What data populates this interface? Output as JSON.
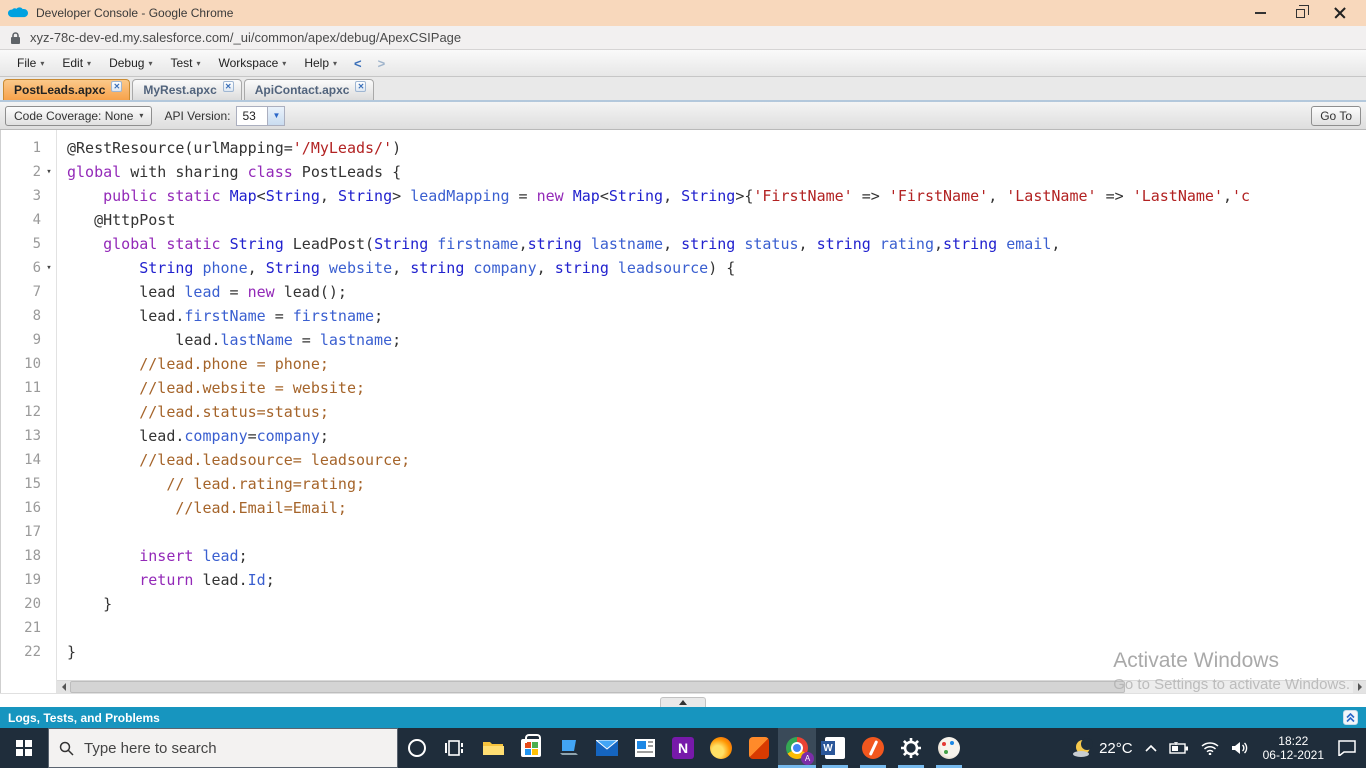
{
  "window": {
    "title": "Developer Console - Google Chrome"
  },
  "urlbar": {
    "url": "xyz-78c-dev-ed.my.salesforce.com/_ui/common/apex/debug/ApexCSIPage"
  },
  "menubar": {
    "items": [
      "File",
      "Edit",
      "Debug",
      "Test",
      "Workspace",
      "Help"
    ],
    "nav_back": "<",
    "nav_forward": ">"
  },
  "tabs": [
    {
      "label": "PostLeads.apxc",
      "active": true,
      "close": "✕"
    },
    {
      "label": "MyRest.apxc",
      "active": false,
      "close": "✕"
    },
    {
      "label": "ApiContact.apxc",
      "active": false,
      "close": "✕"
    }
  ],
  "toolbar": {
    "code_coverage_label": "Code Coverage: None",
    "api_version_label": "API Version:",
    "api_version_value": "53",
    "goto_label": "Go To"
  },
  "editor": {
    "colors": {
      "k": "#9329B8",
      "t": "#2121CE",
      "v": "#3A5FD0",
      "s": "#B22222",
      "c": "#A5642A",
      "p": "#333333"
    },
    "lines": [
      {
        "n": 1,
        "fold": false,
        "toks": [
          [
            "p",
            "@RestResource(urlMapping="
          ],
          [
            "s",
            "'/MyLeads/'"
          ],
          [
            "p",
            ")"
          ]
        ]
      },
      {
        "n": 2,
        "fold": true,
        "toks": [
          [
            "k",
            "global"
          ],
          [
            "p",
            " with sharing "
          ],
          [
            "k",
            "class"
          ],
          [
            "p",
            " PostLeads {"
          ]
        ]
      },
      {
        "n": 3,
        "fold": false,
        "toks": [
          [
            "p",
            "    "
          ],
          [
            "k",
            "public"
          ],
          [
            "p",
            " "
          ],
          [
            "k",
            "static"
          ],
          [
            "p",
            " "
          ],
          [
            "t",
            "Map"
          ],
          [
            "p",
            "<"
          ],
          [
            "t",
            "String"
          ],
          [
            "p",
            ", "
          ],
          [
            "t",
            "String"
          ],
          [
            "p",
            "> "
          ],
          [
            "v",
            "leadMapping"
          ],
          [
            "p",
            " = "
          ],
          [
            "k",
            "new"
          ],
          [
            "p",
            " "
          ],
          [
            "t",
            "Map"
          ],
          [
            "p",
            "<"
          ],
          [
            "t",
            "String"
          ],
          [
            "p",
            ", "
          ],
          [
            "t",
            "String"
          ],
          [
            "p",
            ">{"
          ],
          [
            "s",
            "'FirstName'"
          ],
          [
            "p",
            " => "
          ],
          [
            "s",
            "'FirstName'"
          ],
          [
            "p",
            ", "
          ],
          [
            "s",
            "'LastName'"
          ],
          [
            "p",
            " => "
          ],
          [
            "s",
            "'LastName'"
          ],
          [
            "p",
            ","
          ],
          [
            "s",
            "'c"
          ]
        ]
      },
      {
        "n": 4,
        "fold": false,
        "toks": [
          [
            "p",
            "   @HttpPost"
          ]
        ]
      },
      {
        "n": 5,
        "fold": false,
        "toks": [
          [
            "p",
            "    "
          ],
          [
            "k",
            "global"
          ],
          [
            "p",
            " "
          ],
          [
            "k",
            "static"
          ],
          [
            "p",
            " "
          ],
          [
            "t",
            "String"
          ],
          [
            "p",
            " LeadPost("
          ],
          [
            "t",
            "String"
          ],
          [
            "p",
            " "
          ],
          [
            "v",
            "firstname"
          ],
          [
            "p",
            ","
          ],
          [
            "t",
            "string"
          ],
          [
            "p",
            " "
          ],
          [
            "v",
            "lastname"
          ],
          [
            "p",
            ", "
          ],
          [
            "t",
            "string"
          ],
          [
            "p",
            " "
          ],
          [
            "v",
            "status"
          ],
          [
            "p",
            ", "
          ],
          [
            "t",
            "string"
          ],
          [
            "p",
            " "
          ],
          [
            "v",
            "rating"
          ],
          [
            "p",
            ","
          ],
          [
            "t",
            "string"
          ],
          [
            "p",
            " "
          ],
          [
            "v",
            "email"
          ],
          [
            "p",
            ","
          ]
        ]
      },
      {
        "n": 6,
        "fold": true,
        "toks": [
          [
            "p",
            "        "
          ],
          [
            "t",
            "String"
          ],
          [
            "p",
            " "
          ],
          [
            "v",
            "phone"
          ],
          [
            "p",
            ", "
          ],
          [
            "t",
            "String"
          ],
          [
            "p",
            " "
          ],
          [
            "v",
            "website"
          ],
          [
            "p",
            ", "
          ],
          [
            "t",
            "string"
          ],
          [
            "p",
            " "
          ],
          [
            "v",
            "company"
          ],
          [
            "p",
            ", "
          ],
          [
            "t",
            "string"
          ],
          [
            "p",
            " "
          ],
          [
            "v",
            "leadsource"
          ],
          [
            "p",
            ") {"
          ]
        ]
      },
      {
        "n": 7,
        "fold": false,
        "toks": [
          [
            "p",
            "        lead "
          ],
          [
            "v",
            "lead"
          ],
          [
            "p",
            " = "
          ],
          [
            "k",
            "new"
          ],
          [
            "p",
            " lead();"
          ]
        ]
      },
      {
        "n": 8,
        "fold": false,
        "toks": [
          [
            "p",
            "        lead."
          ],
          [
            "v",
            "firstName"
          ],
          [
            "p",
            " = "
          ],
          [
            "v",
            "firstname"
          ],
          [
            "p",
            ";"
          ]
        ]
      },
      {
        "n": 9,
        "fold": false,
        "toks": [
          [
            "p",
            "            lead."
          ],
          [
            "v",
            "lastName"
          ],
          [
            "p",
            " = "
          ],
          [
            "v",
            "lastname"
          ],
          [
            "p",
            ";"
          ]
        ]
      },
      {
        "n": 10,
        "fold": false,
        "toks": [
          [
            "p",
            "        "
          ],
          [
            "c",
            "//lead.phone = phone;"
          ]
        ]
      },
      {
        "n": 11,
        "fold": false,
        "toks": [
          [
            "p",
            "        "
          ],
          [
            "c",
            "//lead.website = website;"
          ]
        ]
      },
      {
        "n": 12,
        "fold": false,
        "toks": [
          [
            "p",
            "        "
          ],
          [
            "c",
            "//lead.status=status;"
          ]
        ]
      },
      {
        "n": 13,
        "fold": false,
        "toks": [
          [
            "p",
            "        lead."
          ],
          [
            "v",
            "company"
          ],
          [
            "p",
            "="
          ],
          [
            "v",
            "company"
          ],
          [
            "p",
            ";"
          ]
        ]
      },
      {
        "n": 14,
        "fold": false,
        "toks": [
          [
            "p",
            "        "
          ],
          [
            "c",
            "//lead.leadsource= leadsource;"
          ]
        ]
      },
      {
        "n": 15,
        "fold": false,
        "toks": [
          [
            "p",
            "           "
          ],
          [
            "c",
            "// lead.rating=rating;"
          ]
        ]
      },
      {
        "n": 16,
        "fold": false,
        "toks": [
          [
            "p",
            "            "
          ],
          [
            "c",
            "//lead.Email=Email;"
          ]
        ]
      },
      {
        "n": 17,
        "fold": false,
        "toks": []
      },
      {
        "n": 18,
        "fold": false,
        "toks": [
          [
            "p",
            "        "
          ],
          [
            "k",
            "insert"
          ],
          [
            "p",
            " "
          ],
          [
            "v",
            "lead"
          ],
          [
            "p",
            ";"
          ]
        ]
      },
      {
        "n": 19,
        "fold": false,
        "toks": [
          [
            "p",
            "        "
          ],
          [
            "k",
            "return"
          ],
          [
            "p",
            " lead."
          ],
          [
            "v",
            "Id"
          ],
          [
            "p",
            ";"
          ]
        ]
      },
      {
        "n": 20,
        "fold": false,
        "toks": [
          [
            "p",
            "    }"
          ]
        ]
      },
      {
        "n": 21,
        "fold": false,
        "toks": []
      },
      {
        "n": 22,
        "fold": false,
        "toks": [
          [
            "p",
            "}"
          ]
        ]
      }
    ]
  },
  "watermark": {
    "line1": "Activate Windows",
    "line2": "Go to Settings to activate Windows."
  },
  "logs_bar": {
    "label": "Logs, Tests, and Problems"
  },
  "taskbar": {
    "search_placeholder": "Type here to search",
    "icons": [
      "start",
      "cortana",
      "task-view",
      "file-explorer",
      "microsoft-store",
      "your-phone",
      "mail",
      "news",
      "onenote",
      "firefox",
      "office",
      "chrome",
      "word",
      "orange-pencil-app",
      "settings",
      "paint"
    ],
    "tray": {
      "temperature": "22°C",
      "time": "18:22",
      "date": "06-12-2021"
    }
  }
}
